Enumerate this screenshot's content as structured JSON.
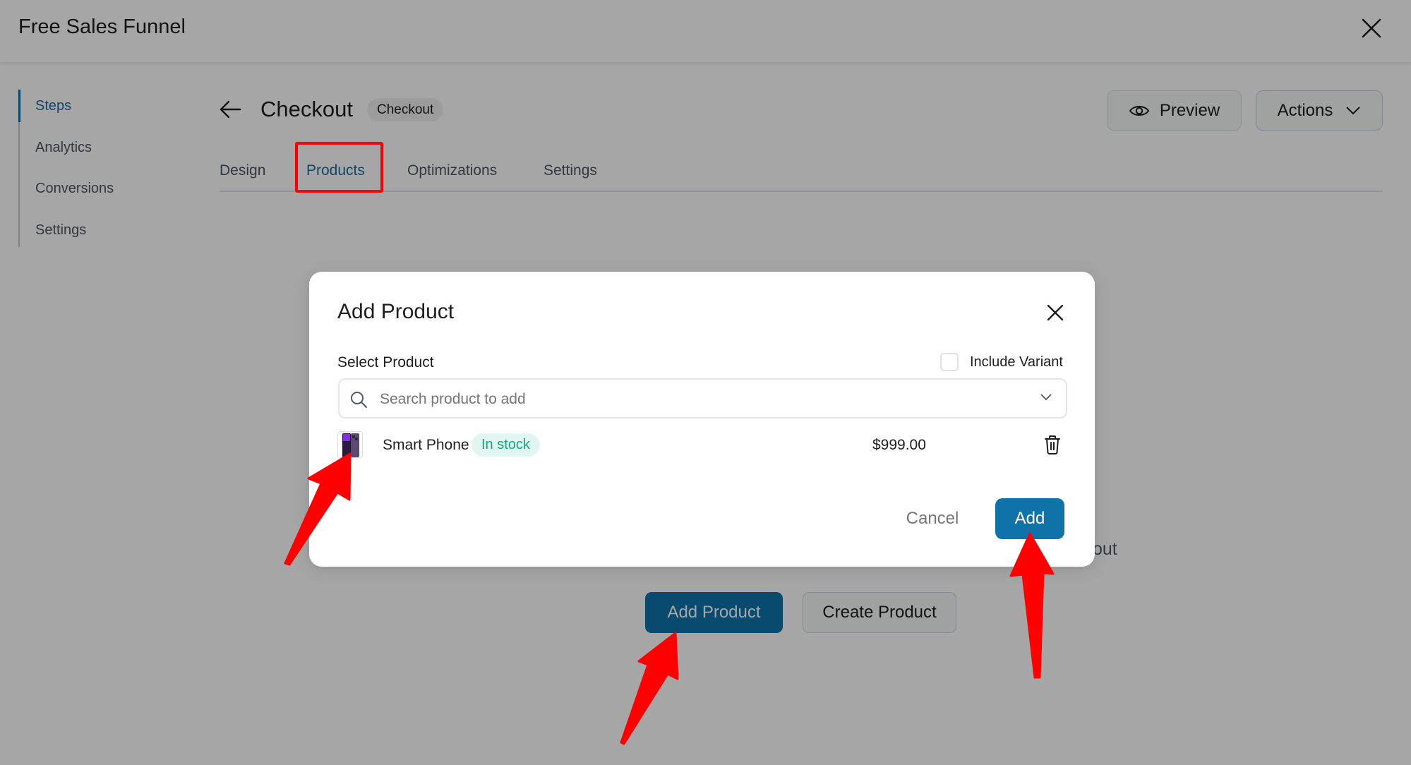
{
  "app": {
    "title": "Free Sales Funnel",
    "close_icon": "close-icon"
  },
  "sidebar": {
    "items": [
      {
        "label": "Steps",
        "active": true
      },
      {
        "label": "Analytics",
        "active": false
      },
      {
        "label": "Conversions",
        "active": false
      },
      {
        "label": "Settings",
        "active": false
      }
    ]
  },
  "header": {
    "back_icon": "arrow-left-icon",
    "title": "Checkout",
    "badge": "Checkout",
    "preview_label": "Preview",
    "preview_icon": "eye-icon",
    "actions_label": "Actions",
    "actions_icon": "chevron-down-icon"
  },
  "tabs": [
    {
      "label": "Design",
      "active": false
    },
    {
      "label": "Products",
      "active": true
    },
    {
      "label": "Optimizations",
      "active": false
    },
    {
      "label": "Settings",
      "active": false
    }
  ],
  "empty_state": {
    "text_fragment": "out",
    "add_product_label": "Add Product",
    "create_product_label": "Create Product"
  },
  "modal": {
    "title": "Add Product",
    "select_label": "Select Product",
    "include_variant_label": "Include Variant",
    "include_variant_checked": false,
    "search": {
      "placeholder": "Search product to add",
      "value": ""
    },
    "products": [
      {
        "name": "Smart Phone",
        "stock_status": "In stock",
        "price": "$999.00"
      }
    ],
    "cancel_label": "Cancel",
    "add_label": "Add"
  },
  "colors": {
    "primary": "#0f73aa",
    "active_text": "#1a6f9c",
    "in_stock_text": "#13a883",
    "in_stock_bg": "#e1f6f1",
    "annotation": "#ff0000"
  }
}
